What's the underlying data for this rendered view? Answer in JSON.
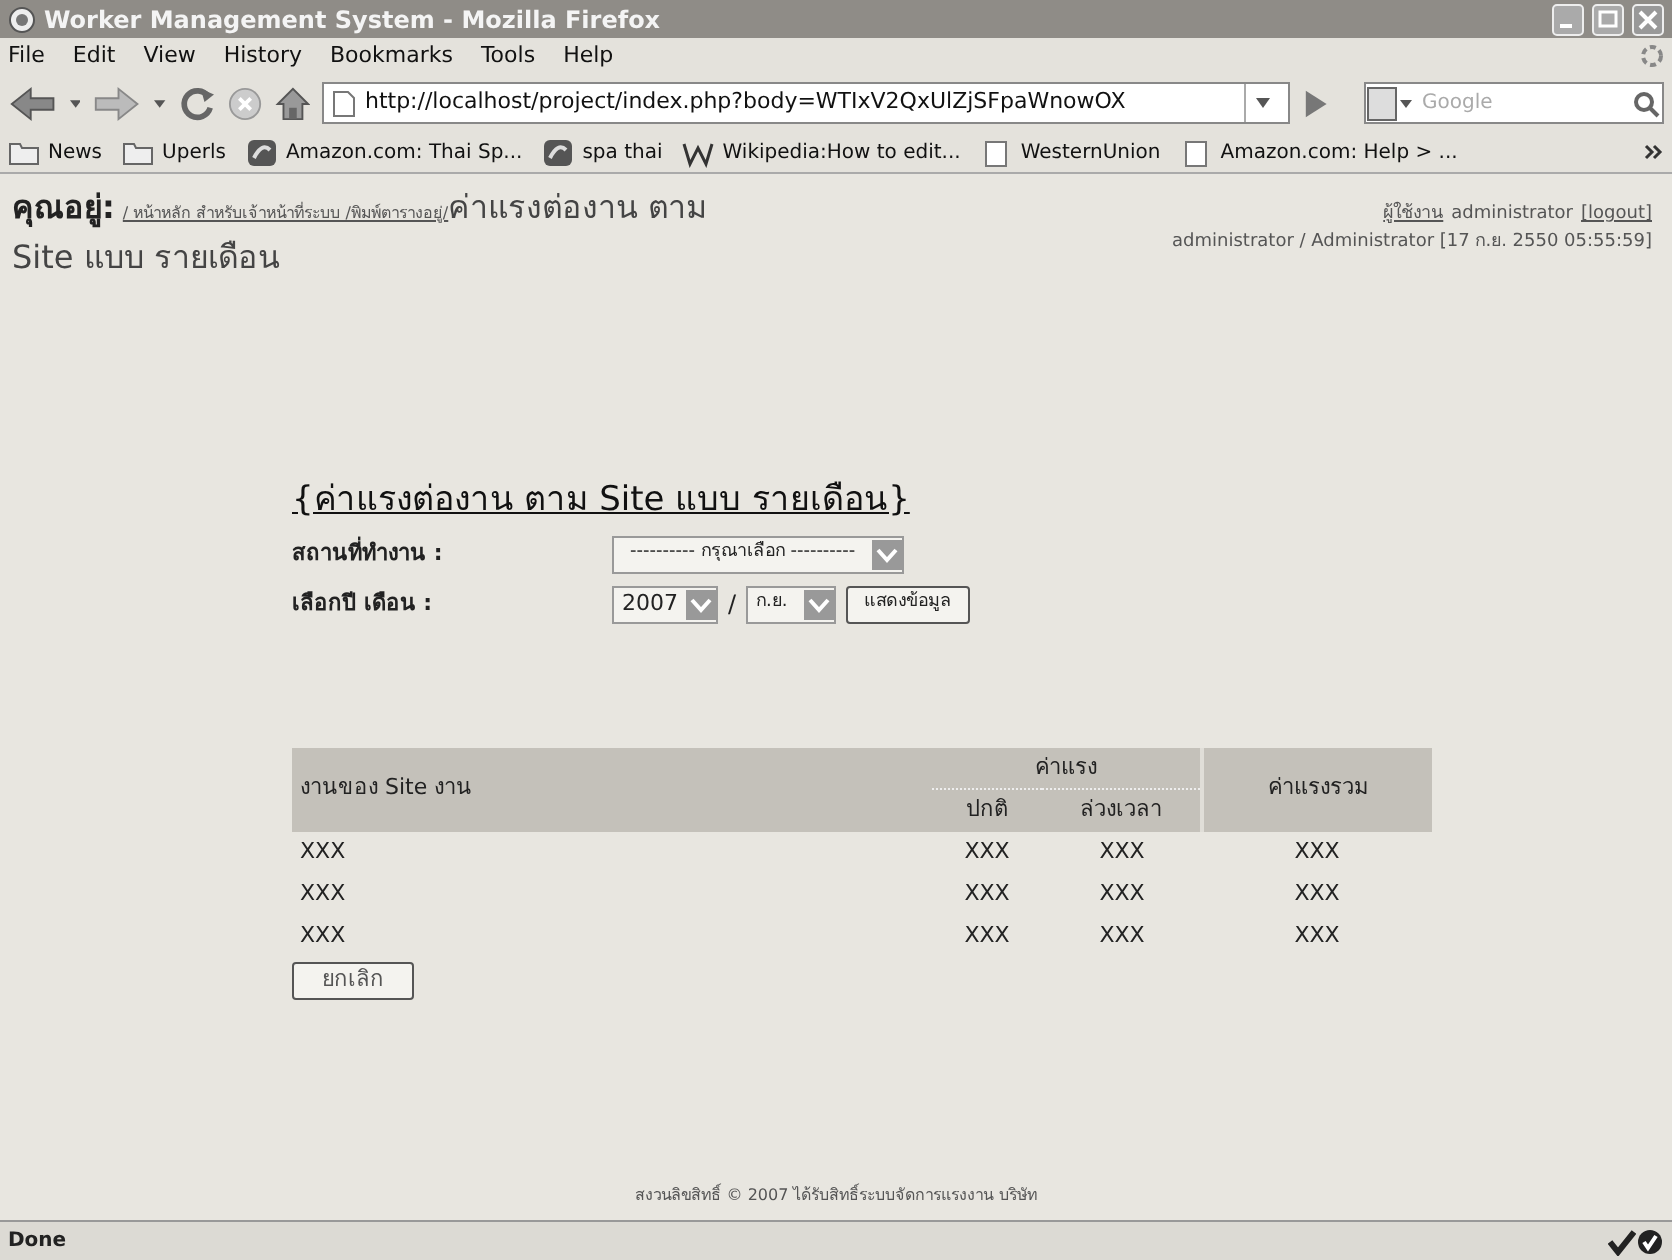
{
  "window": {
    "title": "Worker Management System - Mozilla Firefox"
  },
  "menu": [
    "File",
    "Edit",
    "View",
    "History",
    "Bookmarks",
    "Tools",
    "Help"
  ],
  "address": {
    "value": "http://localhost/project/index.php?body=WTIxV2QxUlZjSFpaWnowOX"
  },
  "search": {
    "placeholder": "Google"
  },
  "bookmarks": [
    {
      "label": "News",
      "kind": "folder"
    },
    {
      "label": "Uperls",
      "kind": "folder"
    },
    {
      "label": "Amazon.com: Thai Sp...",
      "kind": "site"
    },
    {
      "label": "spa thai",
      "kind": "site"
    },
    {
      "label": "Wikipedia:How to edit...",
      "kind": "wiki"
    },
    {
      "label": "WesternUnion",
      "kind": "page"
    },
    {
      "label": "Amazon.com: Help > ...",
      "kind": "page"
    }
  ],
  "breadcrumb": {
    "label": "คุณอยู่:",
    "path": "/ หน้าหลัก สำหรับเจ้าหน้าที่ระบบ /พิมพ์ตารางอยู่/",
    "current": [
      "ค่าแรงต่องาน ตาม",
      "Site แบบ รายเดือน"
    ]
  },
  "user": {
    "line1_label": "ผู้ใช้งาน",
    "line1_name": "administrator",
    "logout": "[logout]",
    "line2": "administrator / Administrator [17 ก.ย. 2550 05:55:59]"
  },
  "form": {
    "title": "{ค่าแรงต่องาน ตาม Site แบบ รายเดือน}",
    "site_label": "สถานที่ทำงาน :",
    "site_value": "---------- กรุณาเลือก ----------",
    "period_label": "เลือกปี เดือน :",
    "year": "2007",
    "separator": "/",
    "month": "ก.ย.",
    "show_button": "แสดงข้อมูล"
  },
  "table": {
    "col_site": "งานของ Site งาน",
    "col_wage": "ค่าแรง",
    "col_normal": "ปกติ",
    "col_overtime": "ล่วงเวลา",
    "col_total": "ค่าแรงรวม",
    "rows": [
      [
        "XXX",
        "XXX",
        "XXX",
        "XXX"
      ],
      [
        "XXX",
        "XXX",
        "XXX",
        "XXX"
      ],
      [
        "XXX",
        "XXX",
        "XXX",
        "XXX"
      ]
    ]
  },
  "cancel_button": "ยกเลิก",
  "footer": "สงวนลิขสิทธิ์ © 2007 ได้รับสิทธิ์ระบบจัดการแรงงาน บริษัท",
  "status_bar": {
    "text": "Done"
  }
}
